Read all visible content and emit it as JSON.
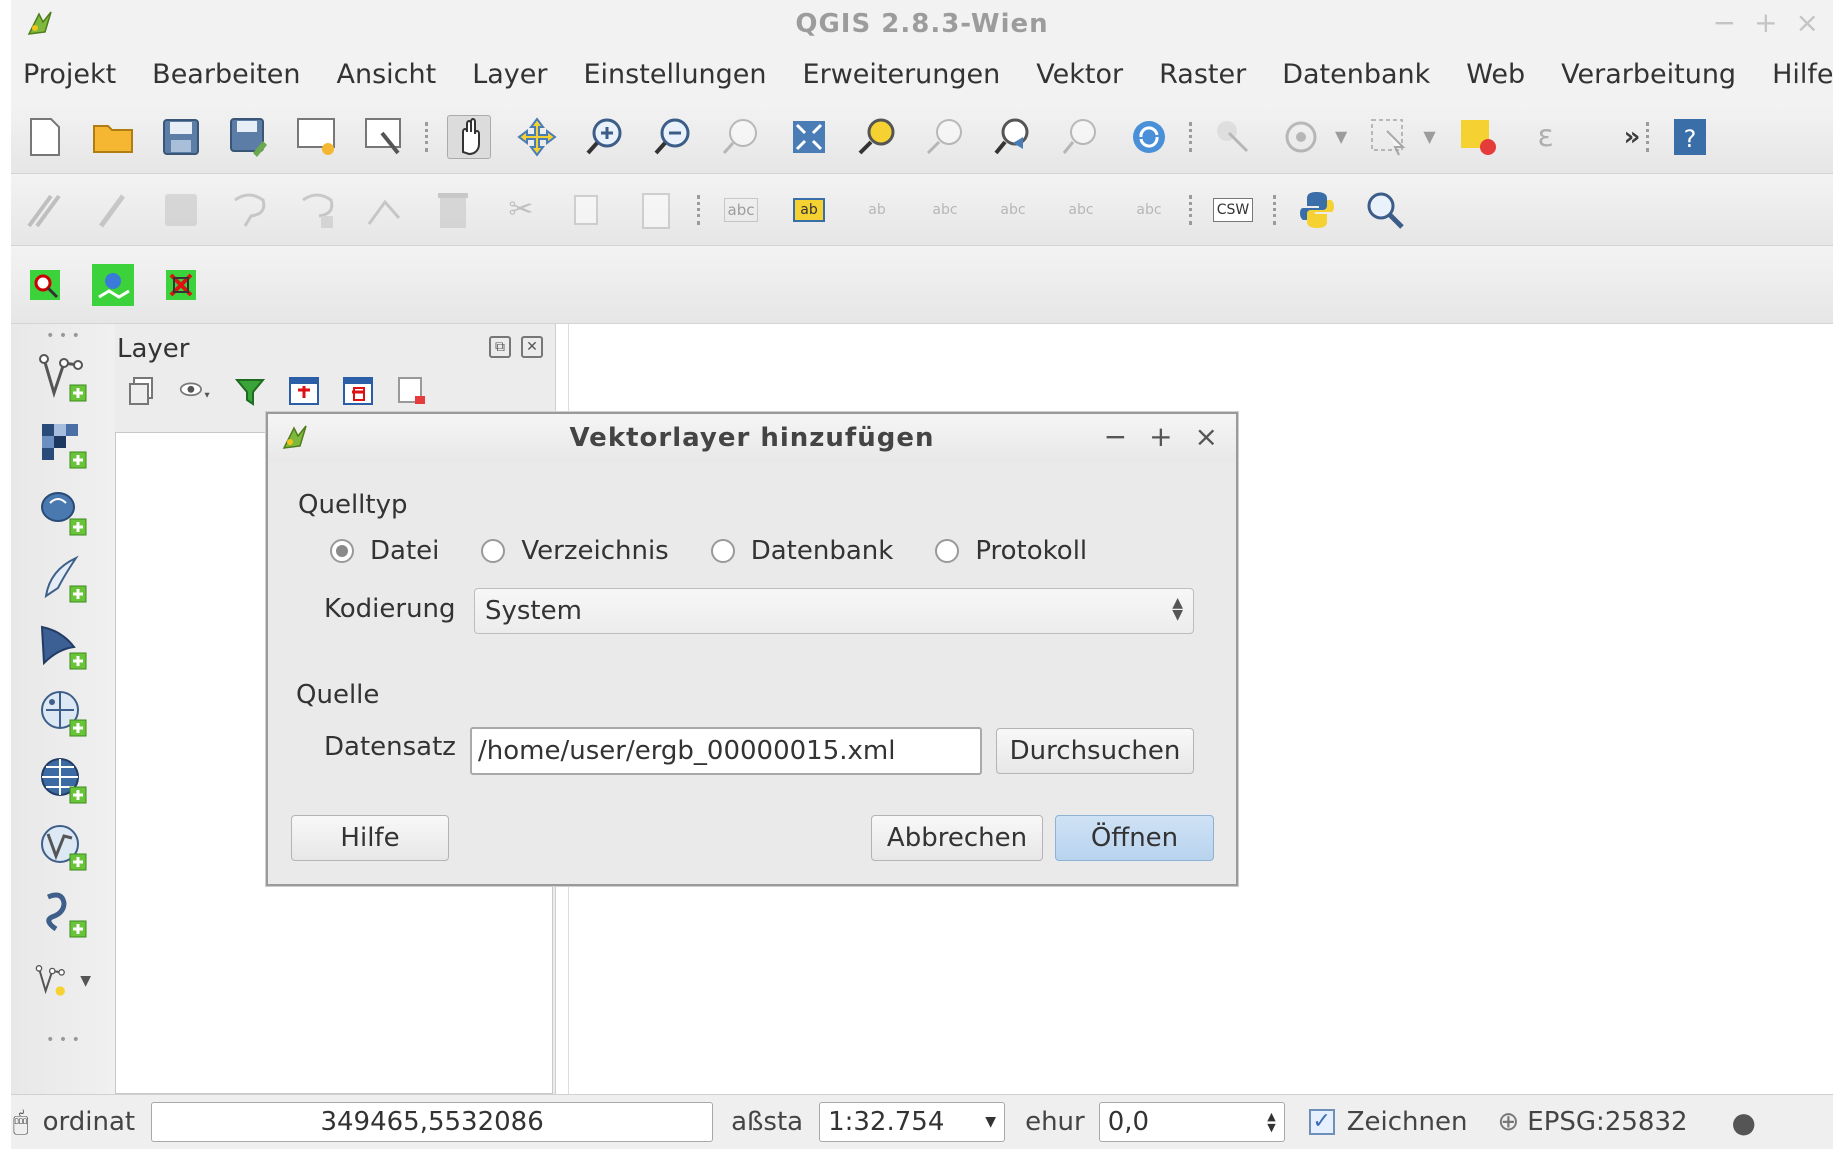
{
  "window": {
    "title": "QGIS 2.8.3-Wien",
    "controls": [
      "−",
      "+",
      "×"
    ]
  },
  "menubar": [
    "Projekt",
    "Bearbeiten",
    "Ansicht",
    "Layer",
    "Einstellungen",
    "Erweiterungen",
    "Vektor",
    "Raster",
    "Datenbank",
    "Web",
    "Verarbeitung",
    "Hilfe"
  ],
  "toolbar_overflow": "»",
  "toolbar2": {
    "label_icons": [
      "abc",
      "ab",
      "ab",
      "abc",
      "abc",
      "abc",
      "abc"
    ],
    "csw_label": "CSW"
  },
  "layer_panel": {
    "title": "Layer"
  },
  "dialog": {
    "title": "Vektorlayer hinzufügen",
    "controls": [
      "−",
      "+",
      "×"
    ],
    "source_type": {
      "label": "Quelltyp",
      "options": [
        "Datei",
        "Verzeichnis",
        "Datenbank",
        "Protokoll"
      ],
      "selected": "Datei"
    },
    "encoding": {
      "label": "Kodierung",
      "value": "System"
    },
    "source": {
      "label": "Quelle",
      "dataset_label": "Datensatz",
      "dataset_value": "/home/user/ergb_00000015.xml",
      "browse_label": "Durchsuchen"
    },
    "buttons": {
      "help": "Hilfe",
      "cancel": "Abbrechen",
      "open": "Öffnen"
    }
  },
  "statusbar": {
    "coord_label": "ordinat",
    "coord_value": "349465,5532086",
    "scale_label": "aßsta",
    "scale_value": "1:32.754",
    "rotation_label": "ehur",
    "rotation_value": "0,0",
    "render_label": "Zeichnen",
    "crs": "EPSG:25832"
  },
  "colors": {
    "accent": "#b8d3ee",
    "window_bg": "#f2f2f2",
    "dialog_bg": "#eaeaea"
  }
}
